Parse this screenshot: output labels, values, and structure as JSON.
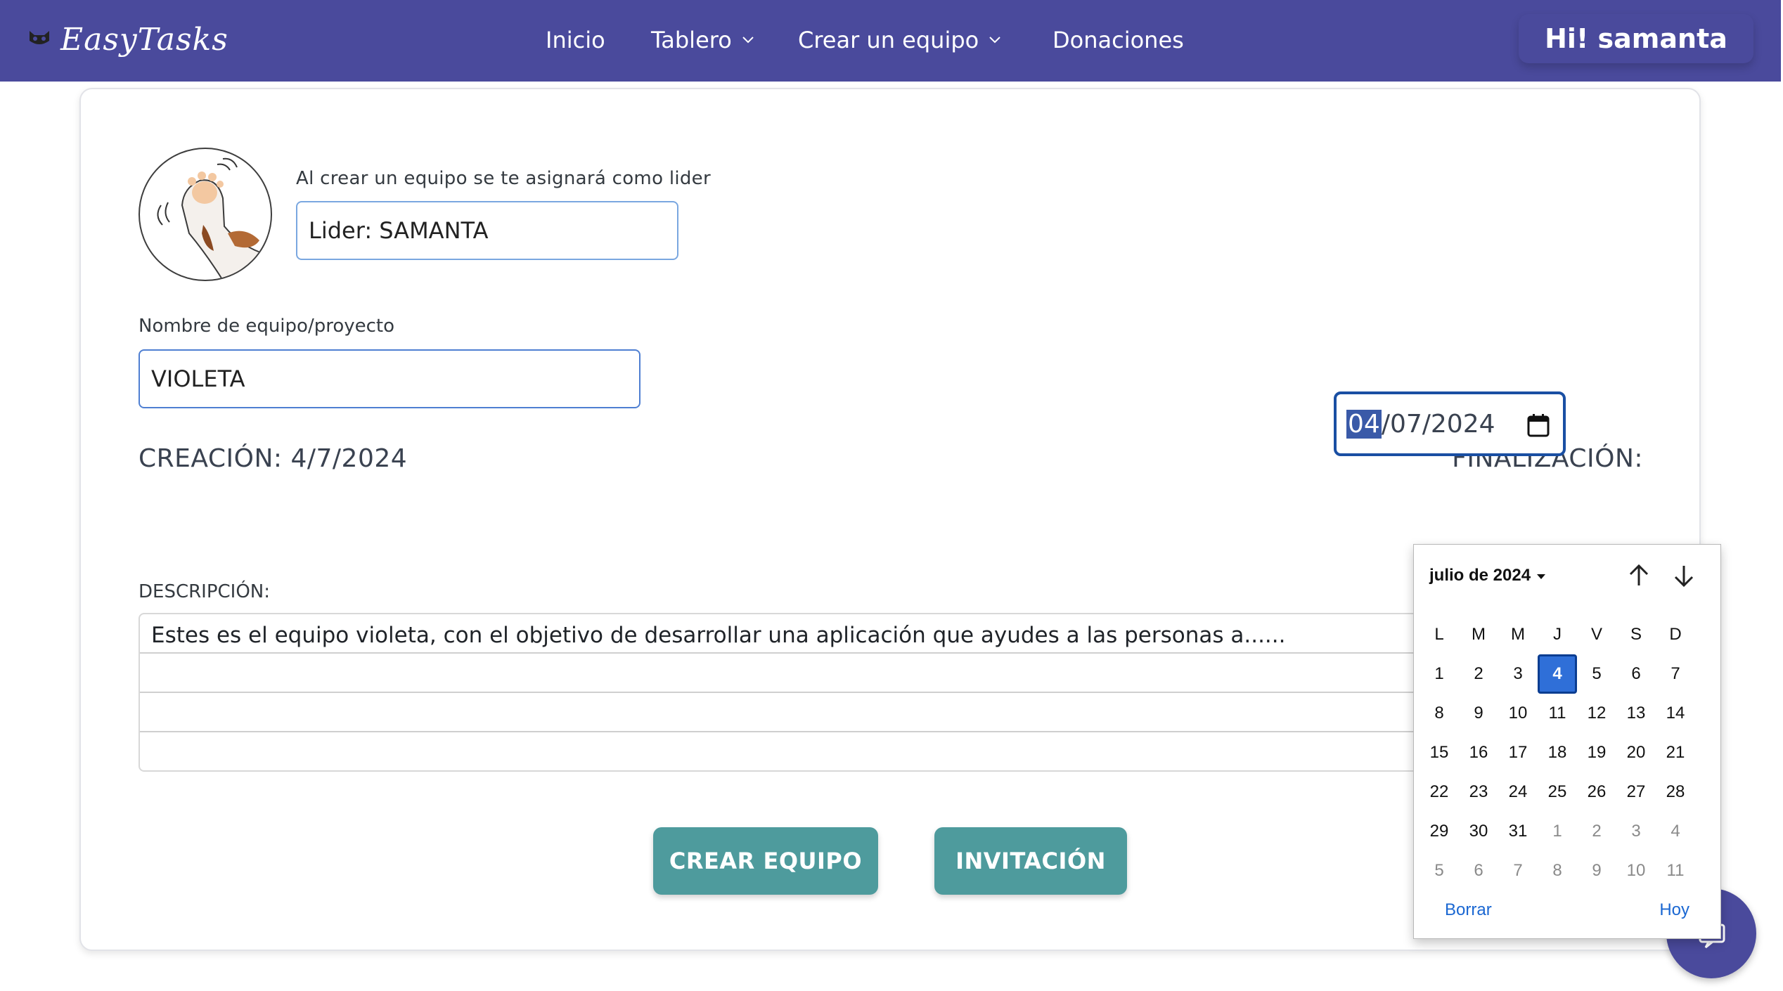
{
  "navbar": {
    "brand": "EasyTasks",
    "links": {
      "home": "Inicio",
      "board": "Tablero",
      "create_team": "Crear un equipo",
      "donations": "Donaciones"
    },
    "user_greeting": "Hi! samanta"
  },
  "form": {
    "leader_caption": "Al crear un equipo se te asignará como lider",
    "leader_value": "Lider: SAMANTA",
    "name_caption": "Nombre de equipo/proyecto",
    "name_value": "VIOLETA",
    "creation_label": "CREACIÓN: 4/7/2024",
    "finalization_label": "FINALIZACIÓN:",
    "finalization_day": "04",
    "finalization_rest": "/07/2024",
    "description_caption": "DESCRIPCIÓN:",
    "description_value": "Estes es el equipo violeta, con el objetivo de desarrollar una aplicación que ayudes a las personas a......",
    "create_button": "CREAR EQUIPO",
    "invite_button": "INVITACIÓN"
  },
  "datepicker": {
    "month_label": "julio de 2024",
    "weekdays": [
      "L",
      "M",
      "M",
      "J",
      "V",
      "S",
      "D"
    ],
    "selected_day": "4",
    "weeks": [
      [
        "1",
        "2",
        "3",
        "4",
        "5",
        "6",
        "7"
      ],
      [
        "8",
        "9",
        "10",
        "11",
        "12",
        "13",
        "14"
      ],
      [
        "15",
        "16",
        "17",
        "18",
        "19",
        "20",
        "21"
      ],
      [
        "22",
        "23",
        "24",
        "25",
        "26",
        "27",
        "28"
      ],
      [
        "29",
        "30",
        "31",
        "1",
        "2",
        "3",
        "4"
      ],
      [
        "5",
        "6",
        "7",
        "8",
        "9",
        "10",
        "11"
      ]
    ],
    "clear": "Borrar",
    "today": "Hoy"
  },
  "colors": {
    "navbar": "#4a4a9c",
    "button": "#4e9b9d",
    "selected_day": "#2f6fd8",
    "link": "#1a67d2"
  }
}
